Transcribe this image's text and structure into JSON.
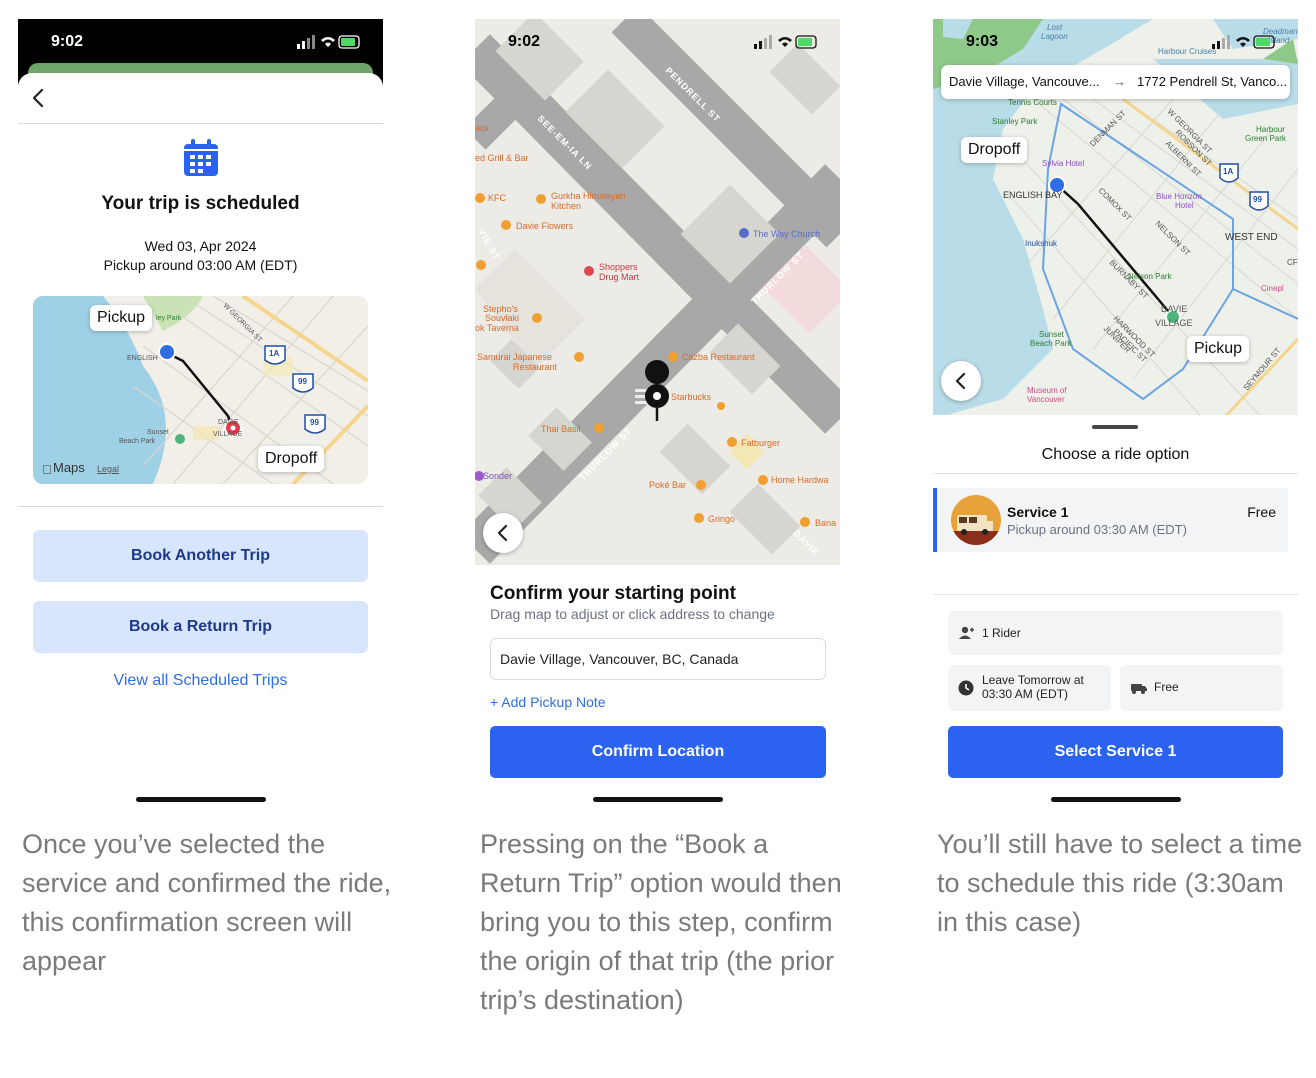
{
  "panel1": {
    "status_time": "9:02",
    "title": "Your trip is scheduled",
    "date": "Wed 03, Apr 2024",
    "pickup_time": "Pickup around 03:00 AM (EDT)",
    "map": {
      "pickup_label": "Pickup",
      "dropoff_label": "Dropoff",
      "maps_logo": "Maps",
      "legal": "Legal",
      "place_labels": [
        "W GEORGIA ST",
        "ENGLISH",
        "Sunset Beach Park",
        "DAVIE VILLAGE",
        "ley Park"
      ],
      "route_shields": [
        "1A",
        "99",
        "99"
      ]
    },
    "book_another_label": "Book Another Trip",
    "book_return_label": "Book a Return Trip",
    "view_all_label": "View all Scheduled Trips",
    "caption": "Once you’ve selected the service and confirmed the ride, this confirmation screen will appear"
  },
  "panel2": {
    "status_time": "9:02",
    "map": {
      "street_labels": [
        "PENDRELL ST",
        "SEE-EM-IA LN",
        "THURLOW ST",
        "THURLOW ST",
        "VIE ST",
        "DAVIE"
      ],
      "poi_labels": [
        "ack",
        "ed Grill & Bar",
        "KFC",
        "Gurkha Himalayan Kitchen",
        "Davie Flowers",
        "The Way Church",
        "Shoppers Drug Mart",
        "Stepho's Souvlaki",
        "ok Taverna",
        "Samurai Japanese Restaurant",
        "Cazba Restaurant",
        "Starbucks",
        "Thai Basil",
        "Fatburger",
        "Sonder",
        "Home Hardwa",
        "Poké Bar",
        "Gringo",
        "Bana"
      ]
    },
    "title": "Confirm your starting point",
    "subtitle": "Drag map to adjust or click address to change",
    "address_value": "Davie Village, Vancouver, BC, Canada",
    "add_note_label": "+ Add Pickup Note",
    "confirm_label": "Confirm Location",
    "caption": "Pressing on the “Book a Return Trip” option would then bring you to this step, confirm the origin of that trip (the prior trip’s destination)"
  },
  "panel3": {
    "status_time": "9:03",
    "route_from": "Davie Village, Vancouve...",
    "route_arrow": "→",
    "route_to": "1772 Pendrell St, Vanco...",
    "map": {
      "dropoff_label": "Dropoff",
      "pickup_label": "Pickup",
      "place_labels": [
        "Lost Lagoon",
        "Deadman Island",
        "Harbour Cruises",
        "Tennis Courts",
        "Stanley Park",
        "DENMAN ST",
        "W GEORGIA ST",
        "ROBSON ST",
        "ALBERNI ST",
        "Harbour Green Park",
        "Sylvia Hotel",
        "ENGLISH BAY",
        "COMOX ST",
        "Blue Horizon Hotel",
        "WEST END",
        "NELSON ST",
        "Inukshuk",
        "BURNABY ST",
        "Nelson Park",
        "DAVIE VILLAGE",
        "Cinepl",
        "HARWOOD ST",
        "JUNIPER",
        "PACIFIC ST",
        "Sunset Beach Park",
        "SEYMOUR ST",
        "Museum of Vancouver",
        "CF"
      ],
      "route_shields": [
        "1A",
        "99"
      ]
    },
    "sheet_title": "Choose a ride option",
    "service_name": "Service 1",
    "service_pickup": "Pickup around 03:30 AM (EDT)",
    "service_price": "Free",
    "riders_label": "1 Rider",
    "leave_label_1": "Leave Tomorrow at",
    "leave_label_2": "03:30 AM (EDT)",
    "fare_label": "Free",
    "select_label": "Select Service 1",
    "caption": "You’ll still have to select a time to schedule this ride (3:30am in this case)"
  },
  "colors": {
    "primary_blue": "#2b63f0",
    "light_button": "#d8e6fd",
    "link_blue": "#2f6de4",
    "caption_gray": "#7a7a7a"
  }
}
